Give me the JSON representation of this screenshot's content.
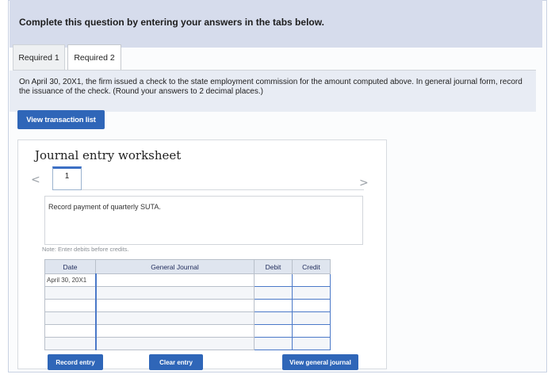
{
  "banner": {
    "text": "Complete this question by entering your answers in the tabs below."
  },
  "tabs": [
    {
      "label": "Required 1"
    },
    {
      "label": "Required 2"
    }
  ],
  "instructions": {
    "text": "On April 30, 20X1, the firm issued a check to the state employment commission for the amount computed above. In general journal form, record the issuance of the check. (Round your answers to 2 decimal places.)"
  },
  "buttons": {
    "view_transaction_list": "View transaction list",
    "record_entry": "Record entry",
    "clear_entry": "Clear entry",
    "view_general_journal": "View general journal"
  },
  "worksheet": {
    "title": "Journal entry worksheet",
    "prev_icon": "<",
    "next_icon": ">",
    "current_page": "1",
    "record_text": "Record payment of quarterly SUTA.",
    "note": "Note: Enter debits before credits.",
    "table": {
      "headers": {
        "date": "Date",
        "general_journal": "General Journal",
        "debit": "Debit",
        "credit": "Credit"
      },
      "first_date": "April 30, 20X1"
    }
  },
  "colors": {
    "accent": "#2f66b8",
    "banner_bg": "#d6dcec",
    "instructions_bg": "#e8ecf4"
  }
}
